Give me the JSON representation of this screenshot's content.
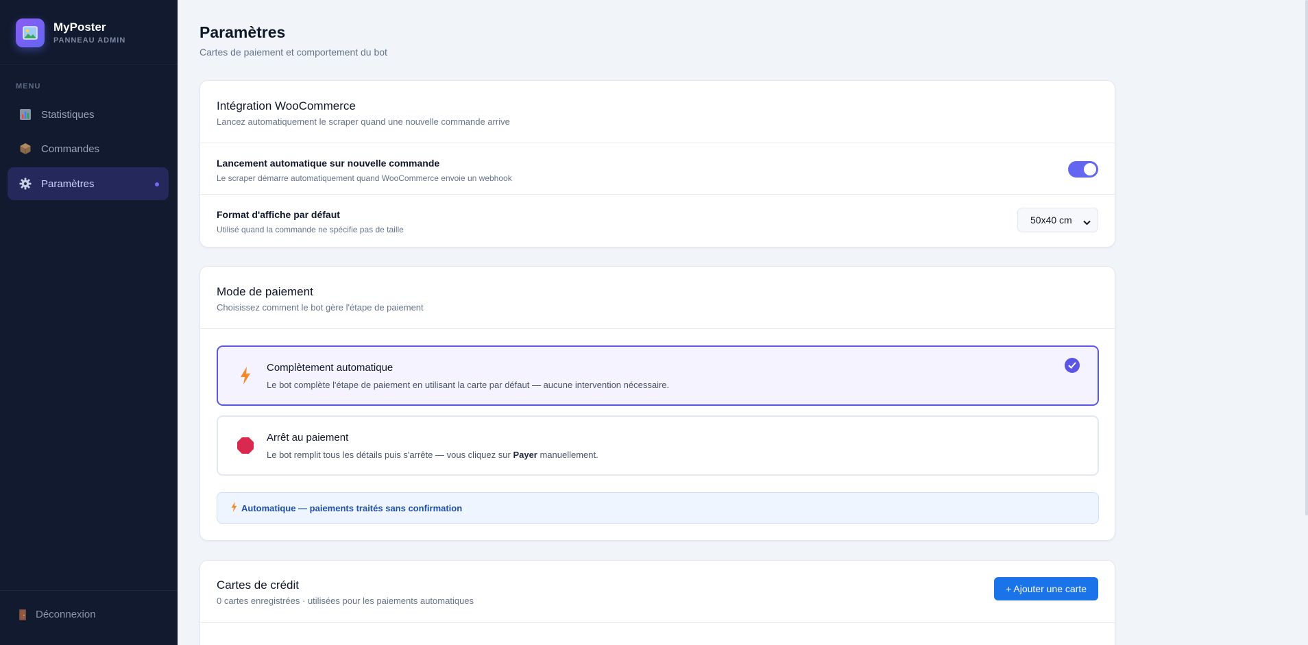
{
  "sidebar": {
    "brand_name": "MyPoster",
    "brand_sub": "PANNEAU ADMIN",
    "menu_label": "MENU",
    "items": [
      {
        "label": "Statistiques",
        "icon": "bar-chart-icon"
      },
      {
        "label": "Commandes",
        "icon": "package-icon"
      },
      {
        "label": "Paramètres",
        "icon": "gear-icon",
        "active": true
      }
    ],
    "logout_label": "Déconnexion"
  },
  "page": {
    "title": "Paramètres",
    "subtitle": "Cartes de paiement et comportement du bot"
  },
  "woocommerce": {
    "title": "Intégration WooCommerce",
    "desc": "Lancez automatiquement le scraper quand une nouvelle commande arrive",
    "auto_launch": {
      "title": "Lancement automatique sur nouvelle commande",
      "desc": "Le scraper démarre automatiquement quand WooCommerce envoie un webhook",
      "enabled": true
    },
    "format": {
      "title": "Format d'affiche par défaut",
      "desc": "Utilisé quand la commande ne spécifie pas de taille",
      "selected": "50x40 cm"
    }
  },
  "payment": {
    "title": "Mode de paiement",
    "desc": "Choisissez comment le bot gère l'étape de paiement",
    "options": [
      {
        "title": "Complètement automatique",
        "desc": "Le bot complète l'étape de paiement en utilisant la carte par défaut — aucune intervention nécessaire.",
        "icon": "lightning-icon",
        "selected": true
      },
      {
        "title": "Arrêt au paiement",
        "desc_before": "Le bot remplit tous les détails puis s'arrête — vous cliquez sur ",
        "desc_bold": "Payer",
        "desc_after": " manuellement.",
        "icon": "stop-sign-icon",
        "selected": false
      }
    ],
    "status_banner": "Automatique — paiements traités sans confirmation"
  },
  "cards": {
    "title": "Cartes de crédit",
    "desc": "0 cartes enregistrées · utilisées pour les paiements automatiques",
    "add_button": "+ Ajouter une carte"
  },
  "colors": {
    "sidebar_bg": "#111a2e",
    "accent": "#5b55e6",
    "primary_button": "#1a73e8",
    "page_bg": "#f1f4f9"
  }
}
